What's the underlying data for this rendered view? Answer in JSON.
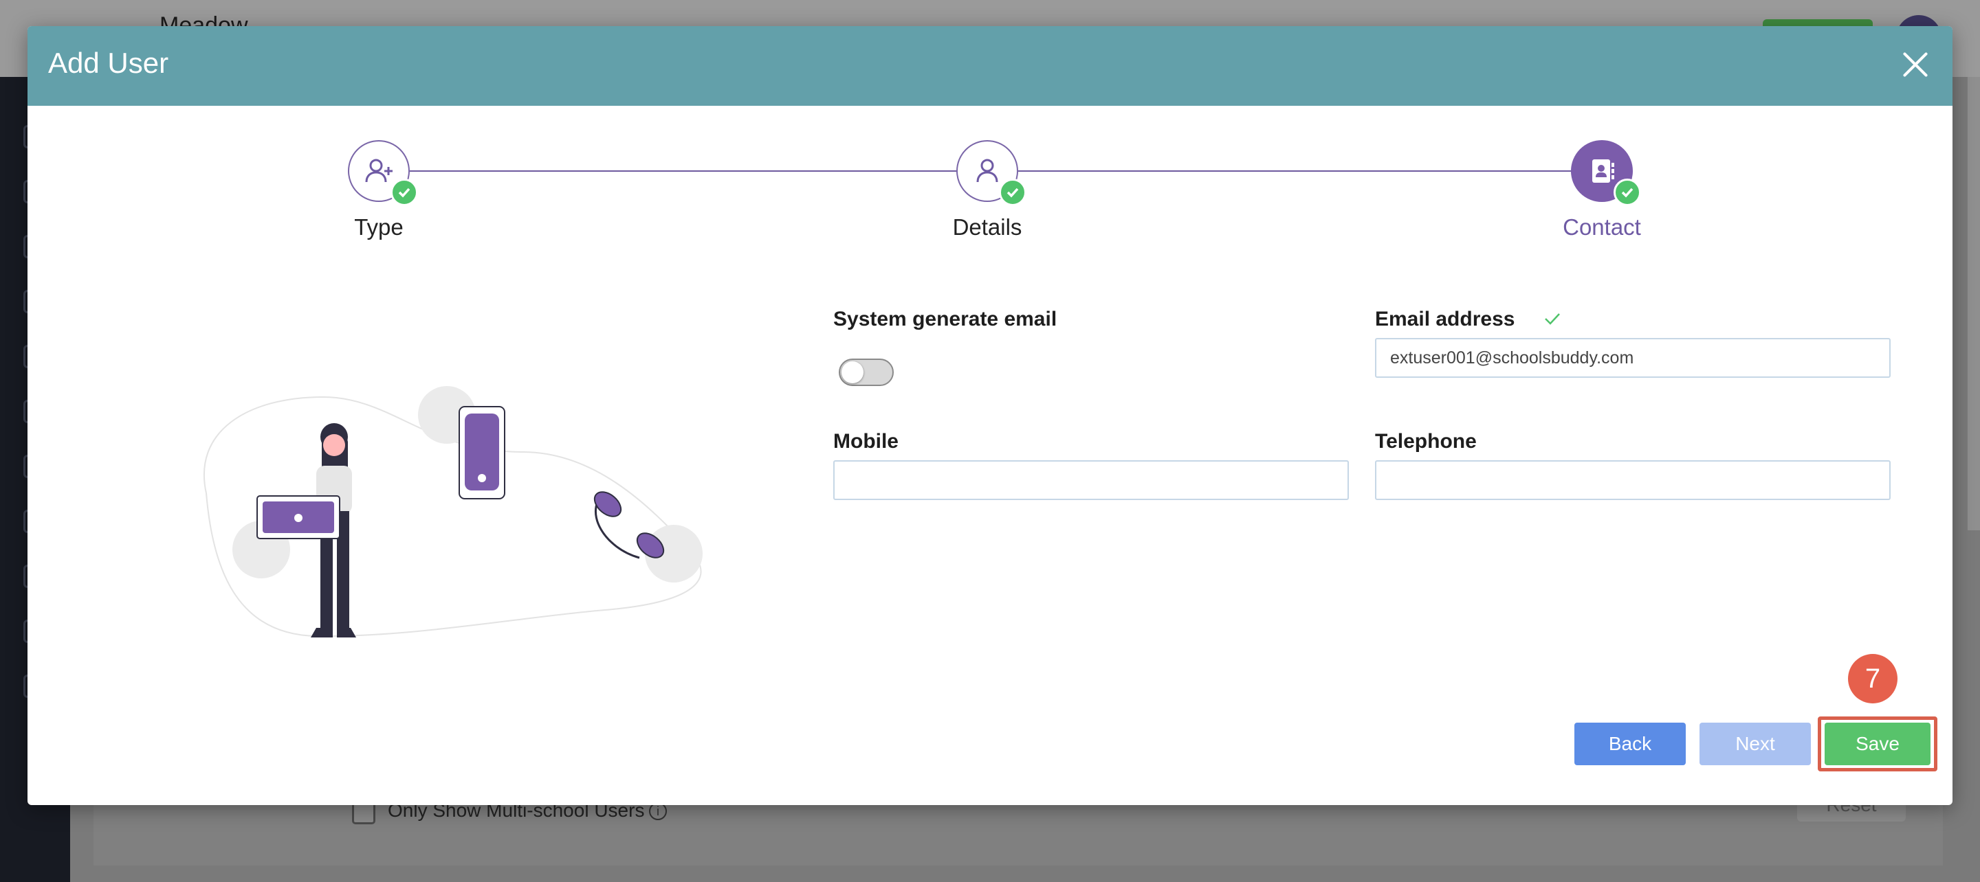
{
  "background": {
    "app_title": "Meadow",
    "filter_checkbox_label": "Only Show Multi-school Users",
    "reset_label": "Reset"
  },
  "modal": {
    "title": "Add User",
    "steps": [
      {
        "label": "Type",
        "state": "completed",
        "icon": "user-plus-icon"
      },
      {
        "label": "Details",
        "state": "completed",
        "icon": "user-icon"
      },
      {
        "label": "Contact",
        "state": "active",
        "icon": "contact-book-icon"
      }
    ],
    "form": {
      "system_email_label": "System generate email",
      "system_email_enabled": false,
      "email_label": "Email address",
      "email_value": "extuser001@schoolsbuddy.com",
      "email_valid": true,
      "mobile_label": "Mobile",
      "mobile_value": "",
      "telephone_label": "Telephone",
      "telephone_value": ""
    },
    "buttons": {
      "back": "Back",
      "next": "Next",
      "save": "Save"
    },
    "step_marker": "7"
  },
  "colors": {
    "header": "#63a0aa",
    "accent_purple": "#7b5cab",
    "success_green": "#58c36b",
    "back_blue": "#5b8ce6",
    "next_disabled_blue": "#a9c1f1",
    "highlight_red": "#d9604c"
  }
}
